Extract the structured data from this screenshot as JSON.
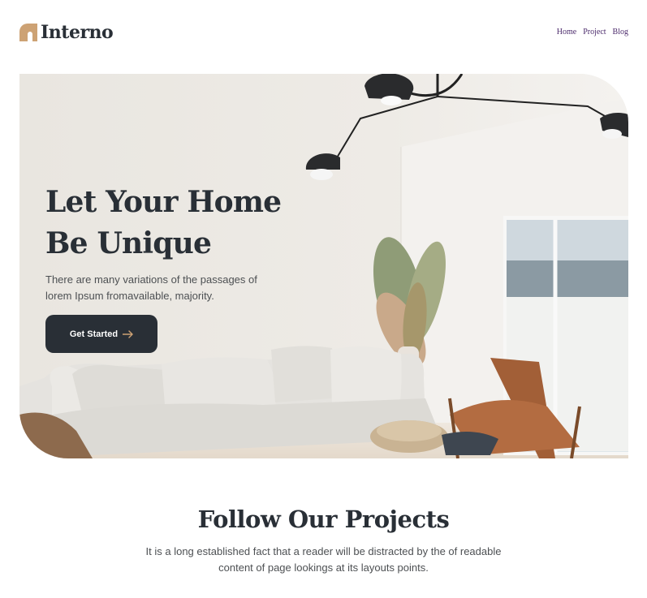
{
  "header": {
    "brand": "Interno",
    "nav": [
      "Home",
      "Project",
      "Blog"
    ]
  },
  "hero": {
    "title": "Let Your Home Be Unique",
    "description": "There are many variations of the passages of lorem Ipsum fromavailable, majority.",
    "cta_label": "Get Started"
  },
  "projects": {
    "title": "Follow Our Projects",
    "description": "It is a long established fact that a reader will be distracted by the of readable content of page lookings at its layouts points."
  },
  "colors": {
    "accent": "#cda274",
    "dark": "#292f36",
    "nav": "#4b2a6b"
  },
  "icons": {
    "logo": "logo-arch-icon",
    "cta": "arrow-right-icon"
  }
}
